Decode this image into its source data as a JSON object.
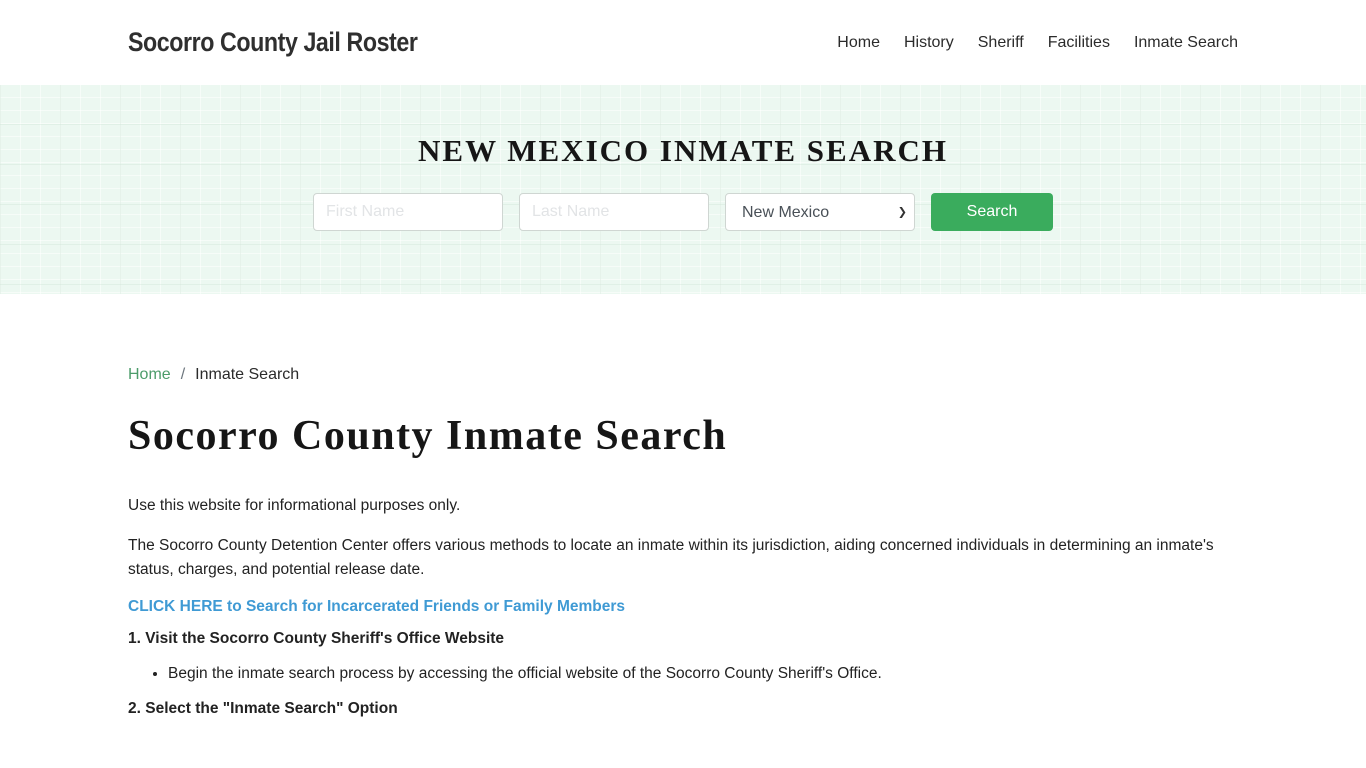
{
  "header": {
    "brand": "Socorro County Jail Roster",
    "nav": [
      {
        "label": "Home"
      },
      {
        "label": "History"
      },
      {
        "label": "Sheriff"
      },
      {
        "label": "Facilities"
      },
      {
        "label": "Inmate Search"
      }
    ]
  },
  "hero": {
    "title": "NEW MEXICO INMATE SEARCH",
    "first_name": {
      "value": "",
      "placeholder": "First Name"
    },
    "last_name": {
      "value": "",
      "placeholder": "Last Name"
    },
    "state_select": {
      "selected": "New Mexico"
    },
    "search_button": "Search"
  },
  "breadcrumb": {
    "home": "Home",
    "separator": "/",
    "current": "Inmate Search"
  },
  "main": {
    "title": "Socorro County Inmate Search",
    "intro": "Use this website for informational purposes only.",
    "description": "The Socorro County Detention Center offers various methods to locate an inmate within its jurisdiction, aiding concerned individuals in determining an inmate's status, charges, and potential release date.",
    "cta_link": "CLICK HERE to Search for Incarcerated Friends or Family Members",
    "steps": [
      {
        "heading": "1. Visit the Socorro County Sheriff's Office Website",
        "bullets": [
          "Begin the inmate search process by accessing the official website of the Socorro County Sheriff's Office."
        ]
      },
      {
        "heading": "2. Select the \"Inmate Search\" Option"
      }
    ]
  },
  "colors": {
    "accent_green": "#3aac5d",
    "breadcrumb_link": "#4c9c6a",
    "cta_link": "#3f9ad4",
    "hero_bg": "#ecf8f1"
  }
}
